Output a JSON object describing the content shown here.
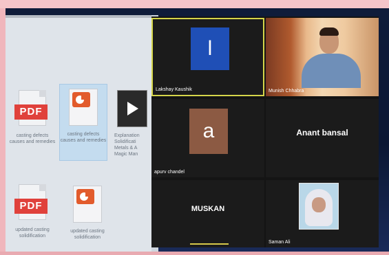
{
  "desktop": {
    "files": [
      {
        "type": "pdf",
        "badge": "PDF",
        "caption": "casting defects causes and remedies"
      },
      {
        "type": "ppt",
        "caption": "casting defects causes and remedies",
        "selected": true
      },
      {
        "type": "video",
        "caption": "Explanation Solidificati Metals & A Magic Man"
      },
      {
        "type": "pdf",
        "badge": "PDF",
        "caption": "updated casting solidification"
      },
      {
        "type": "ppt",
        "caption": "updated casting solidification"
      }
    ]
  },
  "zoom": {
    "participants": [
      {
        "name": "Lakshay Kaushik",
        "avatar_letter": "l",
        "avatar_color": "#1f4fb6",
        "active": true
      },
      {
        "name": "Munish Chhabra",
        "video": true
      },
      {
        "name": "apurv chandel",
        "avatar_letter": "a",
        "avatar_color": "#8c5a43"
      },
      {
        "name": "Anant bansal",
        "center_name": true
      },
      {
        "name": "MUSKAN",
        "center_name": true,
        "speaking": true
      },
      {
        "name": "Saman Ali",
        "photo": true
      }
    ]
  },
  "colors": {
    "pdf_red": "#e0413b",
    "ppt_orange": "#e25b2c",
    "active_border": "#d6d64a",
    "speaking_bar": "#d7c94b"
  }
}
